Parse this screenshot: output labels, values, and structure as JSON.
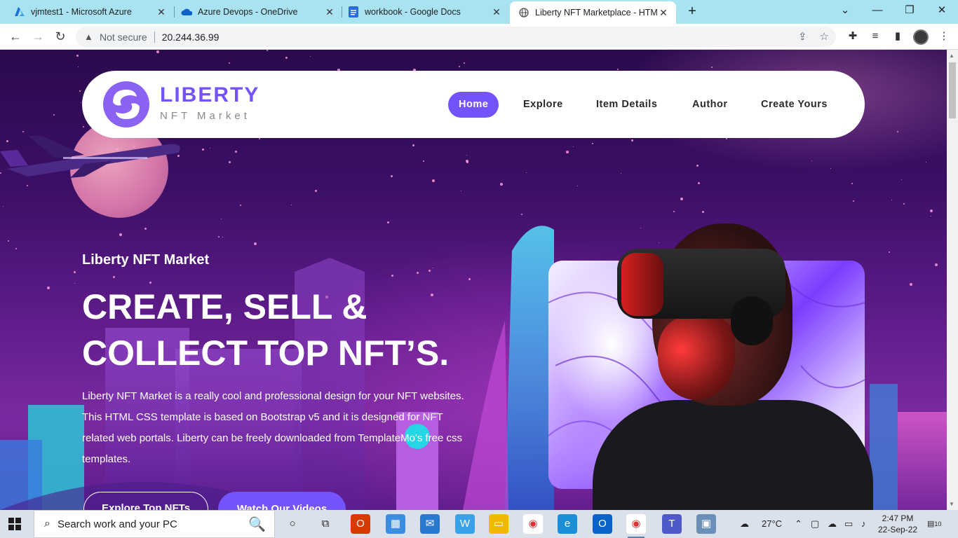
{
  "browser": {
    "tabs": [
      {
        "title": "vjmtest1 - Microsoft Azure",
        "icon": "azure-icon"
      },
      {
        "title": "Azure Devops - OneDrive",
        "icon": "onedrive-icon"
      },
      {
        "title": "workbook - Google Docs",
        "icon": "google-docs-icon"
      },
      {
        "title": "Liberty NFT Marketplace - HTML",
        "icon": "globe-icon",
        "active": true
      }
    ],
    "security_label": "Not secure",
    "url": "20.244.36.99"
  },
  "site": {
    "logo_title": "LIBERTY",
    "logo_subtitle": "NFT Market",
    "nav": [
      "Home",
      "Explore",
      "Item Details",
      "Author",
      "Create Yours"
    ],
    "active_nav": "Home",
    "accent": "#7453fc"
  },
  "hero": {
    "kicker": "Liberty NFT Market",
    "title_line1": "CREATE, SELL &",
    "title_line2": "COLLECT TOP NFT’S.",
    "description": "Liberty NFT Market is a really cool and professional design for your NFT websites. This HTML CSS template is based on Bootstrap v5 and it is designed for NFT related web portals. Liberty can be freely downloaded from TemplateMo's free css templates.",
    "btn_explore": "Explore Top NFTs",
    "btn_videos": "Watch Our Videos"
  },
  "taskbar": {
    "search_placeholder": "Search work and your PC",
    "weather": "27°C",
    "time": "2:47 PM",
    "date": "22-Sep-22",
    "notifications": "10"
  }
}
